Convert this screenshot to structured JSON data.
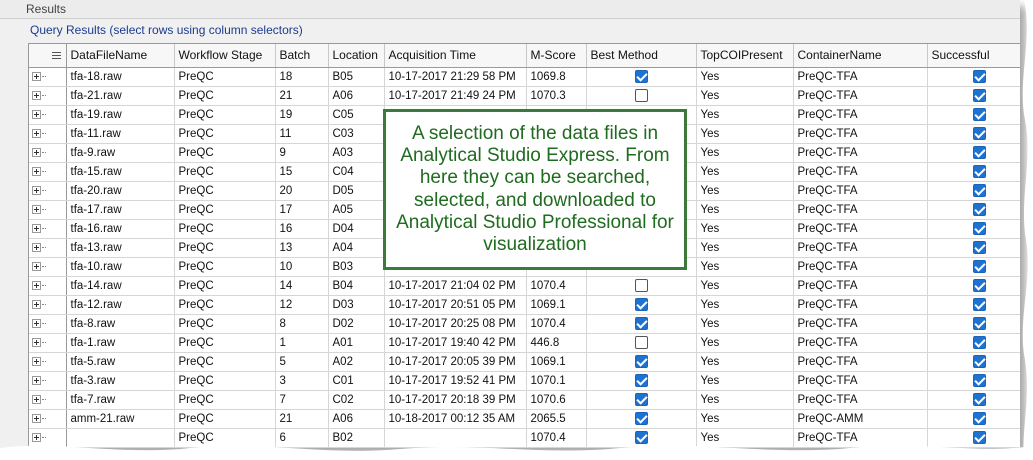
{
  "panel": {
    "title": "Results",
    "query_title": "Query Results (select rows using column selectors)"
  },
  "columns": [
    "DataFileName",
    "Workflow Stage",
    "Batch",
    "Location",
    "Acquisition Time",
    "M-Score",
    "Best Method",
    "TopCOIPresent",
    "ContainerName",
    "Successful"
  ],
  "rows": [
    {
      "file": "tfa-18.raw",
      "stage": "PreQC",
      "batch": "18",
      "location": "B05",
      "time": "10-17-2017 21:29 58 PM",
      "mscore": "1069.8",
      "best": true,
      "topcoi": "Yes",
      "container": "PreQC-TFA",
      "successful": true
    },
    {
      "file": "tfa-21.raw",
      "stage": "PreQC",
      "batch": "21",
      "location": "A06",
      "time": "10-17-2017 21:49 24 PM",
      "mscore": "1070.3",
      "best": false,
      "topcoi": "Yes",
      "container": "PreQC-TFA",
      "successful": true
    },
    {
      "file": "tfa-19.raw",
      "stage": "PreQC",
      "batch": "19",
      "location": "C05",
      "time": "",
      "mscore": "",
      "best": null,
      "topcoi": "Yes",
      "container": "PreQC-TFA",
      "successful": true
    },
    {
      "file": "tfa-11.raw",
      "stage": "PreQC",
      "batch": "11",
      "location": "C03",
      "time": "",
      "mscore": "",
      "best": null,
      "topcoi": "Yes",
      "container": "PreQC-TFA",
      "successful": true
    },
    {
      "file": "tfa-9.raw",
      "stage": "PreQC",
      "batch": "9",
      "location": "A03",
      "time": "",
      "mscore": "",
      "best": null,
      "topcoi": "Yes",
      "container": "PreQC-TFA",
      "successful": true
    },
    {
      "file": "tfa-15.raw",
      "stage": "PreQC",
      "batch": "15",
      "location": "C04",
      "time": "",
      "mscore": "",
      "best": null,
      "topcoi": "Yes",
      "container": "PreQC-TFA",
      "successful": true
    },
    {
      "file": "tfa-20.raw",
      "stage": "PreQC",
      "batch": "20",
      "location": "D05",
      "time": "",
      "mscore": "",
      "best": null,
      "topcoi": "Yes",
      "container": "PreQC-TFA",
      "successful": true
    },
    {
      "file": "tfa-17.raw",
      "stage": "PreQC",
      "batch": "17",
      "location": "A05",
      "time": "",
      "mscore": "",
      "best": null,
      "topcoi": "Yes",
      "container": "PreQC-TFA",
      "successful": true
    },
    {
      "file": "tfa-16.raw",
      "stage": "PreQC",
      "batch": "16",
      "location": "D04",
      "time": "",
      "mscore": "",
      "best": null,
      "topcoi": "Yes",
      "container": "PreQC-TFA",
      "successful": true
    },
    {
      "file": "tfa-13.raw",
      "stage": "PreQC",
      "batch": "13",
      "location": "A04",
      "time": "",
      "mscore": "",
      "best": null,
      "topcoi": "Yes",
      "container": "PreQC-TFA",
      "successful": true
    },
    {
      "file": "tfa-10.raw",
      "stage": "PreQC",
      "batch": "10",
      "location": "B03",
      "time": "",
      "mscore": "",
      "best": null,
      "topcoi": "Yes",
      "container": "PreQC-TFA",
      "successful": true
    },
    {
      "file": "tfa-14.raw",
      "stage": "PreQC",
      "batch": "14",
      "location": "B04",
      "time": "10-17-2017 21:04 02 PM",
      "mscore": "1070.4",
      "best": false,
      "topcoi": "Yes",
      "container": "PreQC-TFA",
      "successful": true
    },
    {
      "file": "tfa-12.raw",
      "stage": "PreQC",
      "batch": "12",
      "location": "D03",
      "time": "10-17-2017 20:51 05 PM",
      "mscore": "1069.1",
      "best": true,
      "topcoi": "Yes",
      "container": "PreQC-TFA",
      "successful": true
    },
    {
      "file": "tfa-8.raw",
      "stage": "PreQC",
      "batch": "8",
      "location": "D02",
      "time": "10-17-2017 20:25 08 PM",
      "mscore": "1070.4",
      "best": true,
      "topcoi": "Yes",
      "container": "PreQC-TFA",
      "successful": true
    },
    {
      "file": "tfa-1.raw",
      "stage": "PreQC",
      "batch": "1",
      "location": "A01",
      "time": "10-17-2017 19:40 42 PM",
      "mscore": "446.8",
      "best": false,
      "topcoi": "Yes",
      "container": "PreQC-TFA",
      "successful": true
    },
    {
      "file": "tfa-5.raw",
      "stage": "PreQC",
      "batch": "5",
      "location": "A02",
      "time": "10-17-2017 20:05 39 PM",
      "mscore": "1069.1",
      "best": true,
      "topcoi": "Yes",
      "container": "PreQC-TFA",
      "successful": true
    },
    {
      "file": "tfa-3.raw",
      "stage": "PreQC",
      "batch": "3",
      "location": "C01",
      "time": "10-17-2017 19:52 41 PM",
      "mscore": "1070.1",
      "best": true,
      "topcoi": "Yes",
      "container": "PreQC-TFA",
      "successful": true
    },
    {
      "file": "tfa-7.raw",
      "stage": "PreQC",
      "batch": "7",
      "location": "C02",
      "time": "10-17-2017 20:18 39 PM",
      "mscore": "1070.6",
      "best": true,
      "topcoi": "Yes",
      "container": "PreQC-TFA",
      "successful": true
    },
    {
      "file": "amm-21.raw",
      "stage": "PreQC",
      "batch": "21",
      "location": "A06",
      "time": "10-18-2017 00:12 35 AM",
      "mscore": "2065.5",
      "best": true,
      "topcoi": "Yes",
      "container": "PreQC-AMM",
      "successful": true
    },
    {
      "file": "",
      "stage": "PreQC",
      "batch": "6",
      "location": "B02",
      "time": "",
      "mscore": "1070.4",
      "best": true,
      "topcoi": "Yes",
      "container": "PreQC-TFA",
      "successful": true
    }
  ],
  "callout": {
    "text": "A selection of the data files in Analytical Studio Express.  From here they can be searched, selected, and downloaded to Analytical Studio Professional for visualization"
  },
  "colors": {
    "checkbox_on": "#1e73d2",
    "callout_border": "#3c7a3c",
    "callout_text": "#1f6b1f",
    "query_title": "#1b3b8f"
  },
  "icons": [
    "expand-plus-icon",
    "column-selector-icon",
    "checkbox-checked-icon",
    "checkbox-unchecked-icon"
  ]
}
